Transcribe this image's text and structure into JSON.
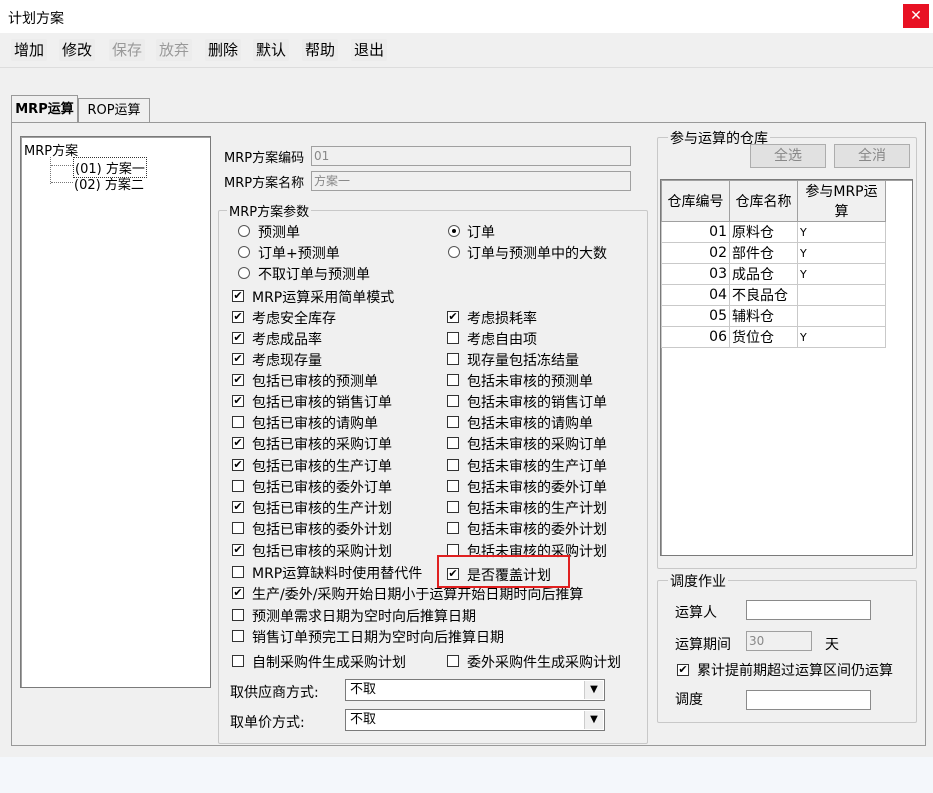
{
  "window": {
    "title": "计划方案",
    "close_symbol": "✕"
  },
  "toolbar": {
    "buttons": [
      "增加",
      "修改",
      "保存",
      "放弃",
      "删除",
      "默认",
      "帮助",
      "退出"
    ]
  },
  "tabs": [
    "MRP运算",
    "ROP运算"
  ],
  "tree": {
    "root": "MRP方案",
    "items": [
      "(01) 方案一",
      "(02) 方案二"
    ]
  },
  "plan": {
    "code_label": "MRP方案编码",
    "code_value": "01",
    "name_label": "MRP方案名称",
    "name_value": "方案一"
  },
  "params": {
    "legend": "MRP方案参数",
    "radios": [
      {
        "label": "预测单",
        "checked": false
      },
      {
        "label": "订单",
        "checked": true
      },
      {
        "label": "订单+预测单",
        "checked": false
      },
      {
        "label": "订单与预测单中的大数",
        "checked": false
      },
      {
        "label": "不取订单与预测单",
        "checked": false
      }
    ],
    "checks": [
      {
        "label": "MRP运算采用简单模式",
        "checked": true
      },
      {
        "label": "考虑安全库存",
        "checked": true
      },
      {
        "label": "考虑损耗率",
        "checked": true
      },
      {
        "label": "考虑成品率",
        "checked": true
      },
      {
        "label": "考虑自由项",
        "checked": false
      },
      {
        "label": "考虑现存量",
        "checked": true
      },
      {
        "label": "现存量包括冻结量",
        "checked": false
      },
      {
        "label": "包括已审核的预测单",
        "checked": true
      },
      {
        "label": "包括未审核的预测单",
        "checked": false
      },
      {
        "label": "包括已审核的销售订单",
        "checked": true
      },
      {
        "label": "包括未审核的销售订单",
        "checked": false
      },
      {
        "label": "包括已审核的请购单",
        "checked": false
      },
      {
        "label": "包括未审核的请购单",
        "checked": false
      },
      {
        "label": "包括已审核的采购订单",
        "checked": true
      },
      {
        "label": "包括未审核的采购订单",
        "checked": false
      },
      {
        "label": "包括已审核的生产订单",
        "checked": true
      },
      {
        "label": "包括未审核的生产订单",
        "checked": false
      },
      {
        "label": "包括已审核的委外订单",
        "checked": false
      },
      {
        "label": "包括未审核的委外订单",
        "checked": false
      },
      {
        "label": "包括已审核的生产计划",
        "checked": true
      },
      {
        "label": "包括未审核的生产计划",
        "checked": false
      },
      {
        "label": "包括已审核的委外计划",
        "checked": false
      },
      {
        "label": "包括未审核的委外计划",
        "checked": false
      },
      {
        "label": "包括已审核的采购计划",
        "checked": true
      },
      {
        "label": "包括未审核的采购计划",
        "checked": false
      },
      {
        "label": "MRP运算缺料时使用替代件",
        "checked": false
      },
      {
        "label": "是否覆盖计划",
        "checked": true
      },
      {
        "label": "生产/委外/采购开始日期小于运算开始日期时向后推算",
        "checked": true
      },
      {
        "label": "预测单需求日期为空时向后推算日期",
        "checked": false
      },
      {
        "label": "销售订单预完工日期为空时向后推算日期",
        "checked": false
      },
      {
        "label": "自制采购件生成采购计划",
        "checked": false
      },
      {
        "label": "委外采购件生成采购计划",
        "checked": false
      }
    ],
    "supplier_label": "取供应商方式:",
    "supplier_value": "不取",
    "price_label": "取单价方式:",
    "price_value": "不取"
  },
  "warehouse": {
    "legend": "参与运算的仓库",
    "select_all": "全选",
    "clear_all": "全消",
    "columns": [
      "仓库编号",
      "仓库名称",
      "参与MRP运算"
    ],
    "rows": [
      [
        "01",
        "原料仓",
        "Y"
      ],
      [
        "02",
        "部件仓",
        "Y"
      ],
      [
        "03",
        "成品仓",
        "Y"
      ],
      [
        "04",
        "不良品仓",
        ""
      ],
      [
        "05",
        "辅料仓",
        ""
      ],
      [
        "06",
        "货位仓",
        "Y"
      ]
    ]
  },
  "schedule": {
    "legend": "调度作业",
    "operator_label": "运算人",
    "operator_value": "",
    "period_label": "运算期间",
    "period_value": "30",
    "period_unit": "天",
    "accumulate_label": "累计提前期超过运算区间仍运算",
    "accumulate_checked": true,
    "dispatch_label": "调度",
    "dispatch_value": ""
  },
  "colors": {
    "close_bg": "#e81123",
    "highlight_border": "#e02020"
  }
}
